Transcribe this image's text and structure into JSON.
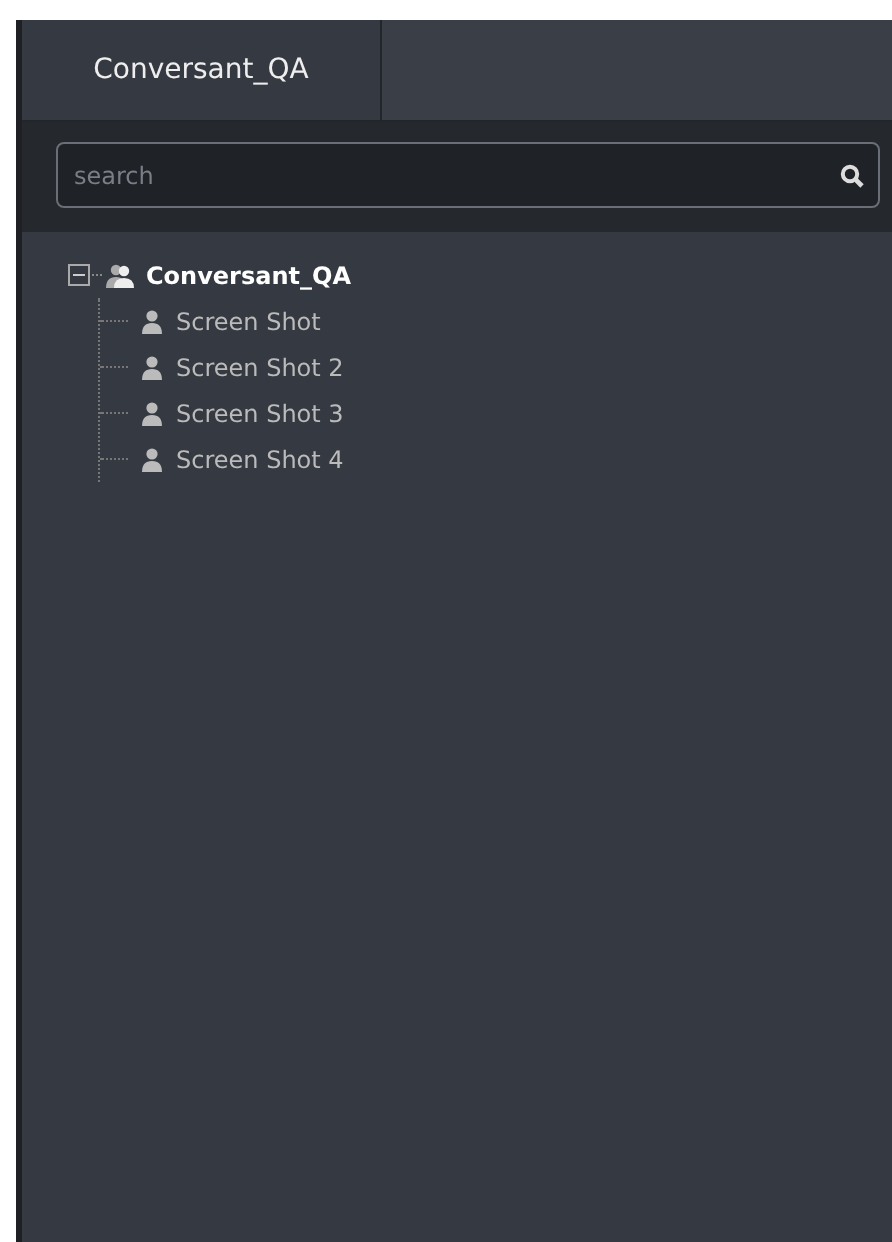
{
  "tabs": [
    {
      "label": "Conversant_QA",
      "selected": true
    }
  ],
  "search": {
    "placeholder": "search"
  },
  "tree": [
    {
      "label": "Conversant_QA",
      "kind": "group",
      "expanded": true,
      "children": [
        {
          "label": "Screen Shot",
          "kind": "user"
        },
        {
          "label": "Screen Shot 2",
          "kind": "user"
        },
        {
          "label": "Screen Shot 3",
          "kind": "user"
        },
        {
          "label": "Screen Shot 4",
          "kind": "user"
        }
      ]
    }
  ]
}
